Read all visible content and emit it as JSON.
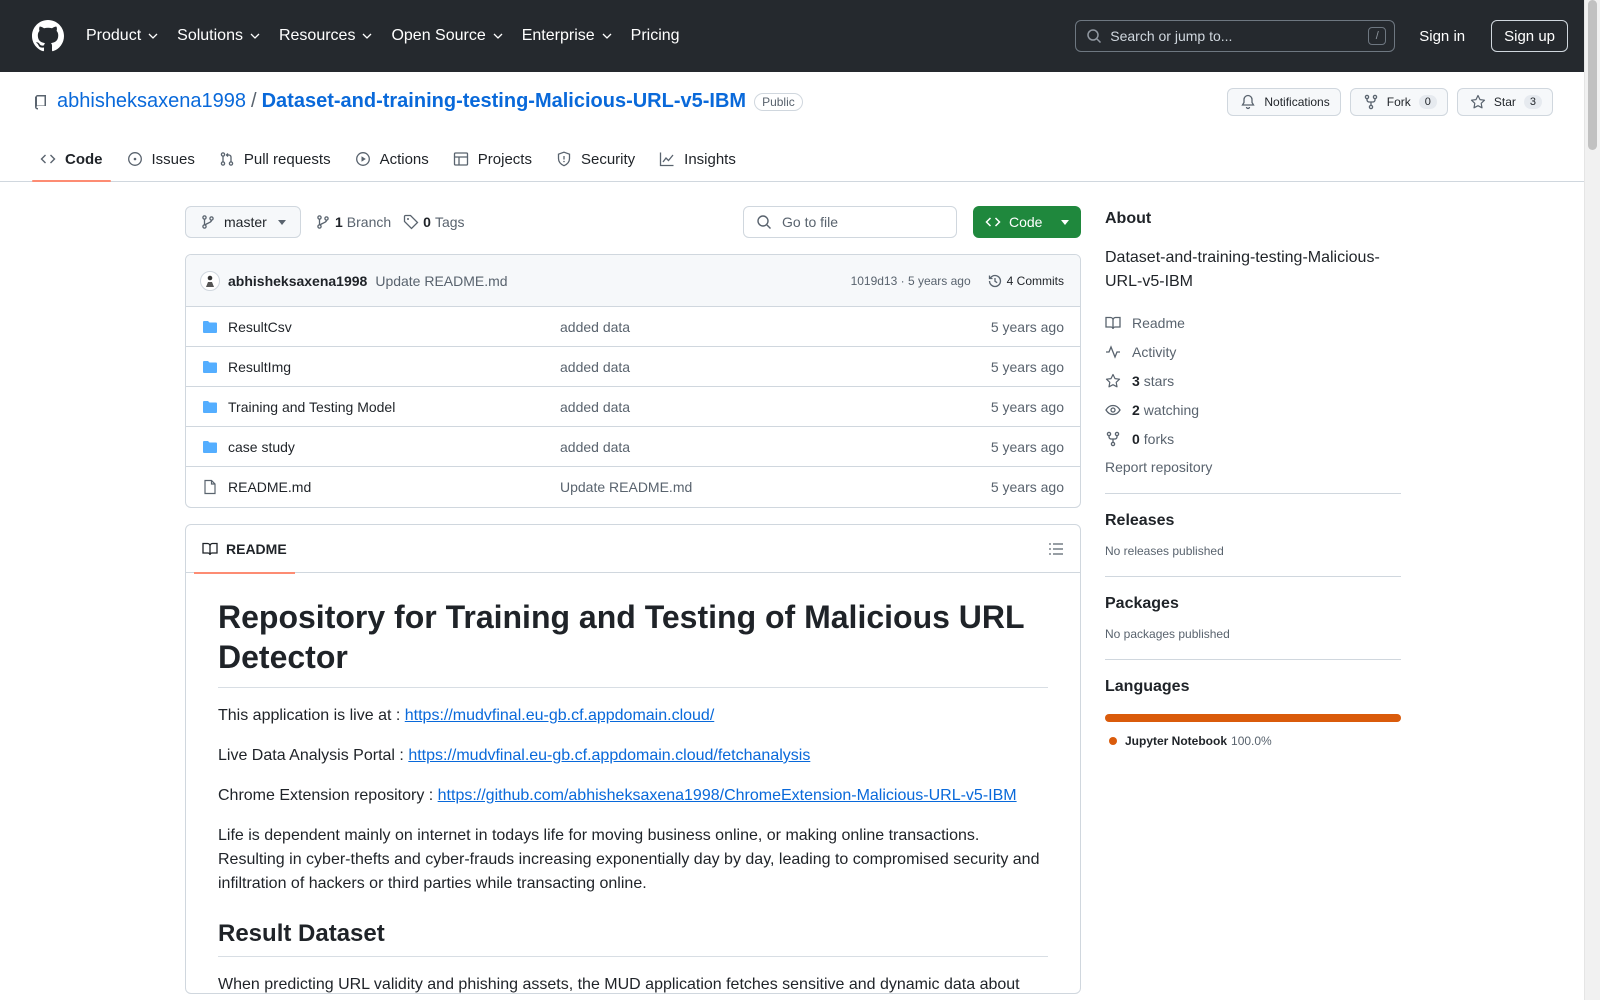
{
  "topnav": {
    "items": [
      {
        "label": "Product",
        "has_menu": true
      },
      {
        "label": "Solutions",
        "has_menu": true
      },
      {
        "label": "Resources",
        "has_menu": true
      },
      {
        "label": "Open Source",
        "has_menu": true
      },
      {
        "label": "Enterprise",
        "has_menu": true
      },
      {
        "label": "Pricing",
        "has_menu": false
      }
    ],
    "search_placeholder": "Search or jump to...",
    "search_shortcut": "/",
    "signin": "Sign in",
    "signup": "Sign up"
  },
  "repo": {
    "owner": "abhisheksaxena1998",
    "separator": "/",
    "name": "Dataset-and-training-testing-Malicious-URL-v5-IBM",
    "visibility": "Public",
    "notifications_label": "Notifications",
    "fork_label": "Fork",
    "fork_count": "0",
    "star_label": "Star",
    "star_count": "3"
  },
  "tabs": [
    {
      "label": "Code",
      "icon": "code-icon",
      "active": true
    },
    {
      "label": "Issues",
      "icon": "issue-icon",
      "active": false
    },
    {
      "label": "Pull requests",
      "icon": "pull-request-icon",
      "active": false
    },
    {
      "label": "Actions",
      "icon": "play-icon",
      "active": false
    },
    {
      "label": "Projects",
      "icon": "table-icon",
      "active": false
    },
    {
      "label": "Security",
      "icon": "shield-icon",
      "active": false
    },
    {
      "label": "Insights",
      "icon": "graph-icon",
      "active": false
    }
  ],
  "toolbar": {
    "branch": "master",
    "branch_count": "1",
    "branch_label": "Branch",
    "tag_count": "0",
    "tag_label": "Tags",
    "goto_placeholder": "Go to file",
    "code_label": "Code"
  },
  "commit": {
    "author": "abhisheksaxena1998",
    "message": "Update README.md",
    "hash_date": "1019d13 · 5 years ago",
    "commits_label": "4 Commits"
  },
  "files": [
    {
      "name": "ResultCsv",
      "type": "folder",
      "message": "added data",
      "date": "5 years ago"
    },
    {
      "name": "ResultImg",
      "type": "folder",
      "message": "added data",
      "date": "5 years ago"
    },
    {
      "name": "Training and Testing Model",
      "type": "folder",
      "message": "added data",
      "date": "5 years ago"
    },
    {
      "name": "case study",
      "type": "folder",
      "message": "added data",
      "date": "5 years ago"
    },
    {
      "name": "README.md",
      "type": "file",
      "message": "Update README.md",
      "date": "5 years ago"
    }
  ],
  "readme": {
    "tab_label": "README",
    "title": "Repository for Training and Testing of Malicious URL Detector",
    "p1_prefix": "This application is live at : ",
    "p1_link": "https://mudvfinal.eu-gb.cf.appdomain.cloud/",
    "p2_prefix": "Live Data Analysis Portal : ",
    "p2_link": "https://mudvfinal.eu-gb.cf.appdomain.cloud/fetchanalysis",
    "p3_prefix": "Chrome Extension repository : ",
    "p3_link": "https://github.com/abhisheksaxena1998/ChromeExtension-Malicious-URL-v5-IBM",
    "p4": "Life is dependent mainly on internet in todays life for moving business online, or making online transactions. Resulting in cyber-thefts and cyber-frauds increasing exponentially day by day, leading to compromised security and infiltration of hackers or third parties while transacting online.",
    "h2": "Result Dataset",
    "p5": "When predicting URL validity and phishing assets, the MUD application fetches sensitive and dynamic data about"
  },
  "sidebar": {
    "about_title": "About",
    "description": "Dataset-and-training-testing-Malicious-URL-v5-IBM",
    "readme": "Readme",
    "activity": "Activity",
    "stars_count": "3",
    "stars_label": "stars",
    "watching_count": "2",
    "watching_label": "watching",
    "forks_count": "0",
    "forks_label": "forks",
    "report": "Report repository",
    "releases_title": "Releases",
    "releases_empty": "No releases published",
    "packages_title": "Packages",
    "packages_empty": "No packages published",
    "languages_title": "Languages",
    "language_name": "Jupyter Notebook",
    "language_pct": "100.0%",
    "language_color": "#DA5B0B"
  }
}
